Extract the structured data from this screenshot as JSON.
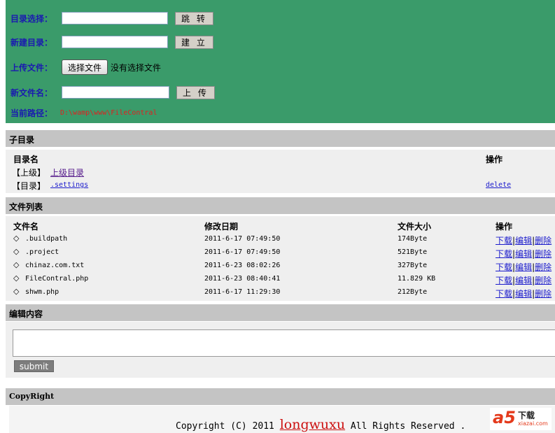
{
  "form": {
    "dir_select": {
      "label": "目录选择：",
      "value": "",
      "button": "跳 转"
    },
    "new_dir": {
      "label": "新建目录：",
      "value": "",
      "button": "建 立"
    },
    "upload": {
      "label": "上传文件：",
      "file_button": "选择文件",
      "no_file": "没有选择文件"
    },
    "new_filename": {
      "label": "新文件名：",
      "value": "",
      "button": "上 传"
    },
    "current_path": {
      "label": "当前路径：",
      "value": "D:\\wamp\\www\\FileContral"
    }
  },
  "subdirs": {
    "heading": "子目录",
    "col_name": "目录名",
    "col_op": "操作",
    "rows": [
      {
        "tag": "【上级】",
        "name": "上级目录",
        "op": ""
      },
      {
        "tag": "【目录】",
        "name": ".settings",
        "op": "delete"
      }
    ]
  },
  "files": {
    "heading": "文件列表",
    "col_name": "文件名",
    "col_date": "修改日期",
    "col_size": "文件大小",
    "col_op": "操作",
    "bullet": "◇",
    "actions": {
      "download": "下载",
      "edit": "编辑",
      "delete": "删除",
      "sep": "|"
    },
    "rows": [
      {
        "name": ".buildpath",
        "date": "2011-6-17 07:49:50",
        "size": "174Byte"
      },
      {
        "name": ".project",
        "date": "2011-6-17 07:49:50",
        "size": "521Byte"
      },
      {
        "name": "chinaz.com.txt",
        "date": "2011-6-23 08:02:26",
        "size": "327Byte"
      },
      {
        "name": "FileContral.php",
        "date": "2011-6-23 08:40:41",
        "size": "11.829 KB"
      },
      {
        "name": "shwm.php",
        "date": "2011-6-17 11:29:30",
        "size": "212Byte"
      }
    ]
  },
  "editor": {
    "heading": "编辑内容",
    "value": "",
    "submit": "submit"
  },
  "footer": {
    "heading": "CopyRight",
    "copy_prefix": "Copyright (C) 2011 ",
    "brand": "longwuxu",
    "copy_suffix": " All Rights Reserved ."
  },
  "logo": {
    "mark": "a5",
    "text": "下载",
    "domain": "xiazai.com"
  },
  "colors": {
    "header_bg": "#3a9b6a",
    "label": "#1a1ab0",
    "path": "#e02020",
    "brand": "#cc1010"
  }
}
